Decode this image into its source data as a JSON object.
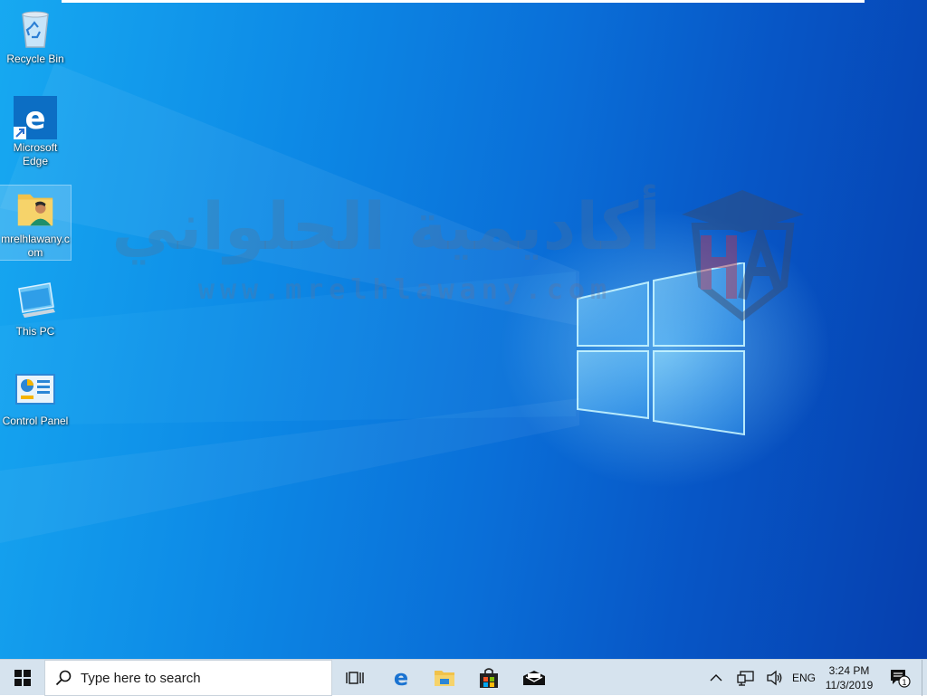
{
  "desktop": {
    "icons": [
      {
        "id": "recycle-bin",
        "label": "Recycle Bin"
      },
      {
        "id": "microsoft-edge",
        "label": "Microsoft Edge"
      },
      {
        "id": "mrelhlawany-folder",
        "label": "mrelhlawany.com"
      },
      {
        "id": "this-pc",
        "label": "This PC"
      },
      {
        "id": "control-panel",
        "label": "Control Panel"
      }
    ],
    "watermark": {
      "arabic_text": "أكاديمية الحلواني",
      "url_text": "www.mrelhlawany.com"
    }
  },
  "taskbar": {
    "search_placeholder": "Type here to search",
    "pinned": [
      {
        "name": "task-view-icon"
      },
      {
        "name": "edge-icon"
      },
      {
        "name": "file-explorer-icon"
      },
      {
        "name": "store-icon"
      },
      {
        "name": "mail-icon"
      }
    ],
    "tray": {
      "language": "ENG",
      "time": "3:24 PM",
      "date": "11/3/2019",
      "notification_count": "1"
    }
  },
  "colors": {
    "accent": "#0078d7",
    "taskbar_bg": "#d6e3ee",
    "edge_blue": "#0c6ec4",
    "folder_yellow": "#f1c24a"
  }
}
